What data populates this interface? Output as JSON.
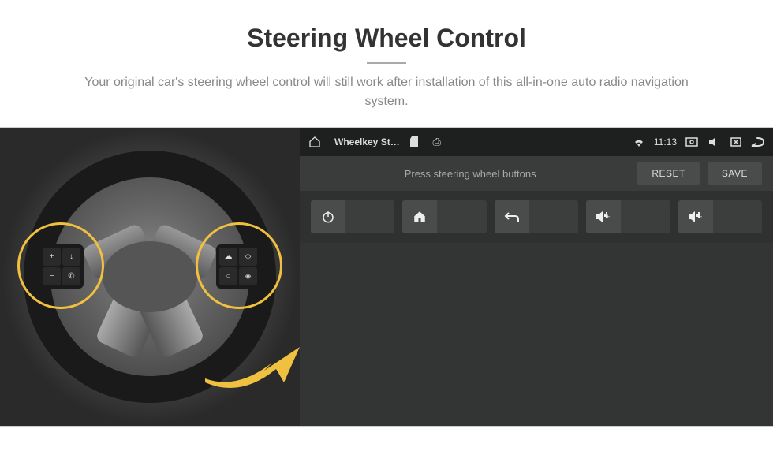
{
  "header": {
    "title": "Steering Wheel Control",
    "subtitle": "Your original car's steering wheel control will still work after installation of this all-in-one auto radio navigation system."
  },
  "wheel": {
    "left_pad": [
      "+",
      "↕",
      "−",
      "✆"
    ],
    "right_pad": [
      "☁",
      "◇",
      "○",
      "◈"
    ]
  },
  "statusbar": {
    "home_icon": "home-icon",
    "app_title": "Wheelkey St…",
    "sd_icon": "sd-icon",
    "usb_icon": "usb-icon",
    "wifi_icon": "wifi-icon",
    "time": "11:13",
    "screenshot_icon": "screenshot-icon",
    "mute_icon": "mute-icon",
    "close_icon": "close-x-icon",
    "back_icon": "back-icon"
  },
  "subbar": {
    "instruction": "Press steering wheel buttons",
    "reset": "RESET",
    "save": "SAVE"
  },
  "controls": [
    {
      "name": "power-control",
      "icon": "power-icon"
    },
    {
      "name": "home-control",
      "icon": "home-icon"
    },
    {
      "name": "back-control",
      "icon": "return-icon"
    },
    {
      "name": "vol-up-control-1",
      "icon": "volume-up-icon"
    },
    {
      "name": "vol-up-control-2",
      "icon": "volume-up-icon"
    }
  ],
  "colors": {
    "highlight": "#f0c040",
    "panel": "#2f3030"
  }
}
